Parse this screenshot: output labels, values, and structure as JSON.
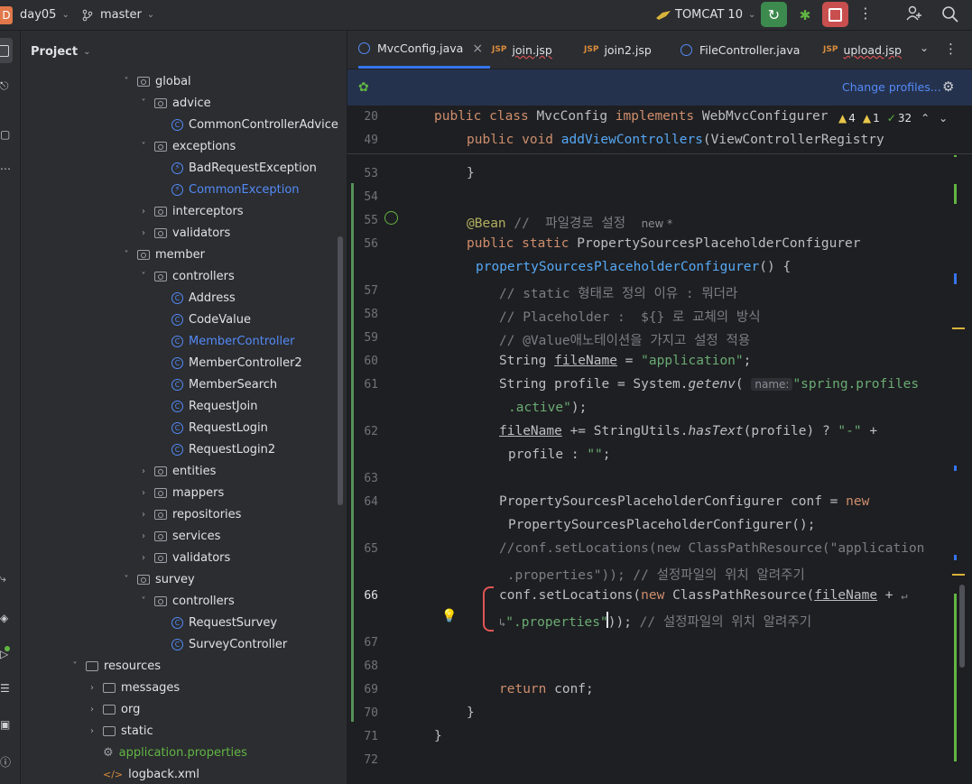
{
  "topbar": {
    "project_badge": "D",
    "project_name": "day05",
    "branch": "master",
    "run_config": "TOMCAT 10"
  },
  "panel": {
    "title": "Project"
  },
  "tree": [
    {
      "label": "global",
      "type": "pkg",
      "expanded": true
    },
    {
      "label": "advice",
      "type": "pkg",
      "expanded": true
    },
    {
      "label": "CommonControllerAdvice",
      "type": "class"
    },
    {
      "label": "exceptions",
      "type": "pkg",
      "expanded": true
    },
    {
      "label": "BadRequestException",
      "type": "exc"
    },
    {
      "label": "CommonException",
      "type": "exc",
      "highlight": "blue"
    },
    {
      "label": "interceptors",
      "type": "pkg",
      "expanded": false
    },
    {
      "label": "validators",
      "type": "pkg",
      "expanded": false
    },
    {
      "label": "member",
      "type": "pkg",
      "expanded": true
    },
    {
      "label": "controllers",
      "type": "pkg",
      "expanded": true
    },
    {
      "label": "Address",
      "type": "class"
    },
    {
      "label": "CodeValue",
      "type": "class"
    },
    {
      "label": "MemberController",
      "type": "class",
      "highlight": "blue"
    },
    {
      "label": "MemberController2",
      "type": "class"
    },
    {
      "label": "MemberSearch",
      "type": "class"
    },
    {
      "label": "RequestJoin",
      "type": "class"
    },
    {
      "label": "RequestLogin",
      "type": "class"
    },
    {
      "label": "RequestLogin2",
      "type": "class"
    },
    {
      "label": "entities",
      "type": "pkg",
      "expanded": false
    },
    {
      "label": "mappers",
      "type": "pkg",
      "expanded": false
    },
    {
      "label": "repositories",
      "type": "pkg",
      "expanded": false
    },
    {
      "label": "services",
      "type": "pkg",
      "expanded": false
    },
    {
      "label": "validators",
      "type": "pkg",
      "expanded": false
    },
    {
      "label": "survey",
      "type": "pkg",
      "expanded": true
    },
    {
      "label": "controllers",
      "type": "pkg",
      "expanded": true
    },
    {
      "label": "RequestSurvey",
      "type": "class"
    },
    {
      "label": "SurveyController",
      "type": "class"
    },
    {
      "label": "resources",
      "type": "folder",
      "expanded": true
    },
    {
      "label": "messages",
      "type": "folder",
      "expanded": false
    },
    {
      "label": "org",
      "type": "folder",
      "expanded": false
    },
    {
      "label": "static",
      "type": "folder",
      "expanded": false
    },
    {
      "label": "application.properties",
      "type": "props",
      "highlight": "green"
    },
    {
      "label": "logback.xml",
      "type": "xml"
    }
  ],
  "tabs": [
    {
      "label": "MvcConfig.java",
      "kind": "java",
      "active": true,
      "close": "×"
    },
    {
      "label": "join.jsp",
      "kind": "jsp"
    },
    {
      "label": "join2.jsp",
      "kind": "jsp"
    },
    {
      "label": "FileController.java",
      "kind": "java"
    },
    {
      "label": "upload.jsp",
      "kind": "jsp"
    }
  ],
  "jsp_badge": "JSP",
  "profile_bar": {
    "link": "Change profiles..."
  },
  "inspections": {
    "warnings": "4",
    "weak": "1",
    "typos": "32"
  },
  "sticky_lines": [
    {
      "ln": "20",
      "text": "public class MvcConfig implements WebMvcConfigurer"
    },
    {
      "ln": "49",
      "text": "    public void addViewControllers(ViewControllerRegistry"
    }
  ],
  "code": {
    "l53": "53",
    "l54": "54",
    "l55": "55",
    "l56": "56",
    "l57": "57",
    "l58": "58",
    "l59": "59",
    "l60": "60",
    "l61": "61",
    "l62": "62",
    "l63": "63",
    "l64": "64",
    "l65": "65",
    "l66": "66",
    "l67": "67",
    "l68": "68",
    "l69": "69",
    "l70": "70",
    "l71": "71",
    "l72": "72",
    "annotation": "@Bean",
    "annotation_comment": "//  파일경로 설정",
    "new_hint": "new *",
    "comment57": "// static 형태로 정의 이유 : 뭐더라",
    "comment58": "// Placeholder :  ${} 로 교체의 방식",
    "comment59": "// @Value애노테이션을 가지고 설정 적용",
    "str_application": "\"application\"",
    "param_hint": "name:",
    "str_profiles": "\"spring.profiles",
    "str_profiles2": ".active\"",
    "str_dash": "\"-\"",
    "str_empty": "\"\"",
    "comment65a": "//conf.setLocations(new ClassPathResource(\"application",
    "comment65b": " .properties\")); // 설정파일의 위치 알려주기",
    "str_props": "\".properties\"",
    "comment66": "// 설정파일의 위치 알려주기"
  }
}
